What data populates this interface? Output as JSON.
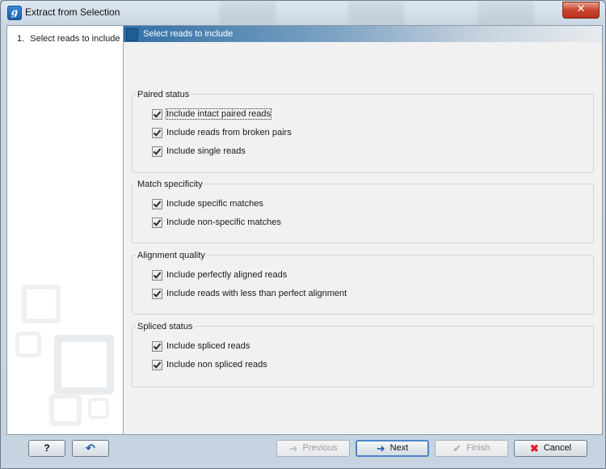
{
  "window": {
    "title": "Extract from Selection",
    "close_glyph": "✕",
    "app_icon_letter": "g"
  },
  "steps": [
    {
      "number": "1.",
      "label": "Select reads to include"
    }
  ],
  "panel": {
    "header": "Select reads to include"
  },
  "groups": [
    {
      "title": "Paired status",
      "options": [
        {
          "label": "Include intact paired reads",
          "checked": true
        },
        {
          "label": "Include reads from broken pairs",
          "checked": true
        },
        {
          "label": "Include single reads",
          "checked": true
        }
      ]
    },
    {
      "title": "Match specificity",
      "options": [
        {
          "label": "Include specific matches",
          "checked": true
        },
        {
          "label": "Include non-specific matches",
          "checked": true
        }
      ]
    },
    {
      "title": "Alignment quality",
      "options": [
        {
          "label": "Include perfectly aligned reads",
          "checked": true
        },
        {
          "label": "Include reads with less than perfect alignment",
          "checked": true
        }
      ]
    },
    {
      "title": "Spliced status",
      "options": [
        {
          "label": "Include spliced reads",
          "checked": true
        },
        {
          "label": "Include non spliced reads",
          "checked": true
        }
      ]
    }
  ],
  "buttons": {
    "help": {
      "label": "?",
      "icon": "help-icon"
    },
    "reset": {
      "label": "↶",
      "icon": "reset-icon"
    },
    "previous": {
      "label": "Previous",
      "icon": "arrow-left-icon",
      "enabled": false
    },
    "next": {
      "label": "Next",
      "icon": "arrow-right-icon",
      "enabled": true
    },
    "finish": {
      "label": "Finish",
      "icon": "checkmark-icon",
      "enabled": false
    },
    "cancel": {
      "label": "Cancel",
      "icon": "cancel-x-icon",
      "enabled": true
    }
  },
  "colors": {
    "panel_header": "#2f6fa6",
    "close_button": "#c9452f",
    "cancel_icon": "#d22"
  }
}
